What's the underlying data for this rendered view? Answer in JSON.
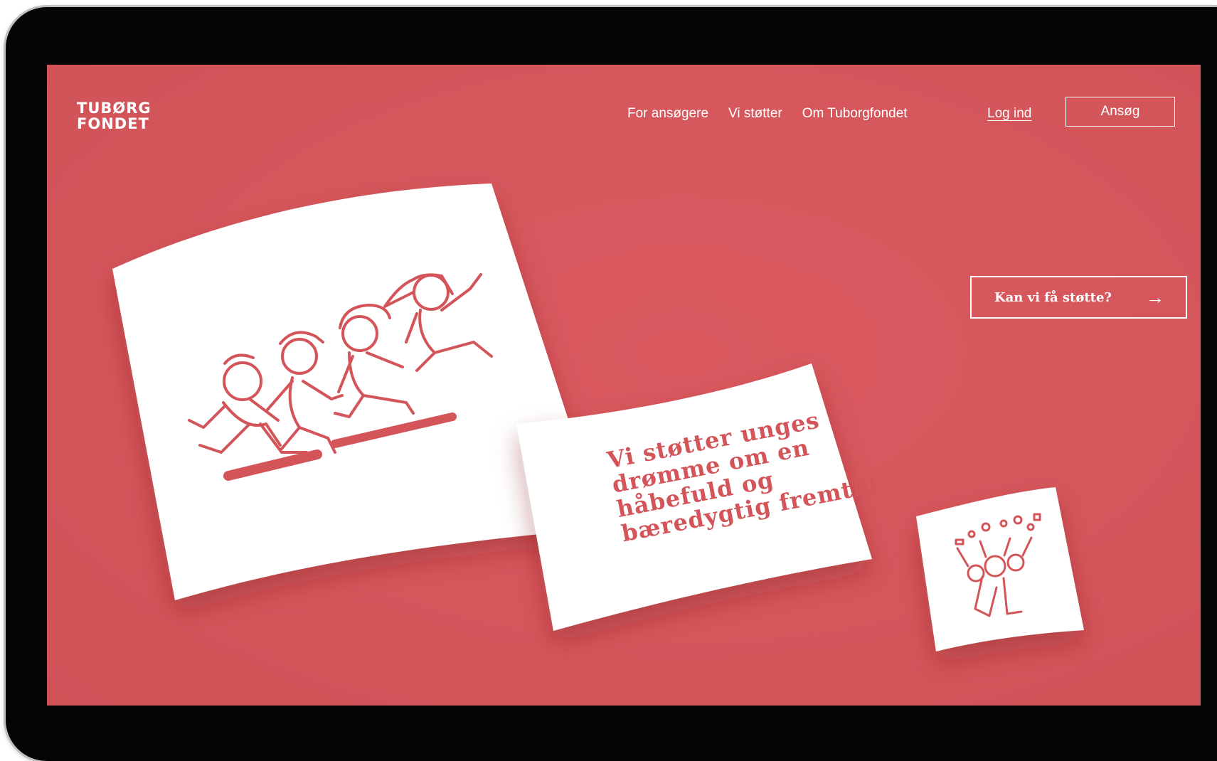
{
  "brand": {
    "logo_line1": "TUBØRG",
    "logo_line2": "FONDET",
    "accent_color": "#d5575c"
  },
  "nav": {
    "items": [
      {
        "label": "For ansøgere"
      },
      {
        "label": "Vi støtter"
      },
      {
        "label": "Om Tuborgfondet"
      }
    ],
    "login_label": "Log ind",
    "apply_label": "Ansøg"
  },
  "cta": {
    "label": "Kan vi få støtte?",
    "icon": "arrow-right-icon"
  },
  "hero": {
    "headline_lines": [
      "Vi støtter unges",
      "drømme om en",
      "håbefuld og",
      "bæredygtig fremtid"
    ]
  },
  "illustrations": {
    "large_card": "running-people-illustration",
    "small_card": "cheering-people-illustration"
  }
}
